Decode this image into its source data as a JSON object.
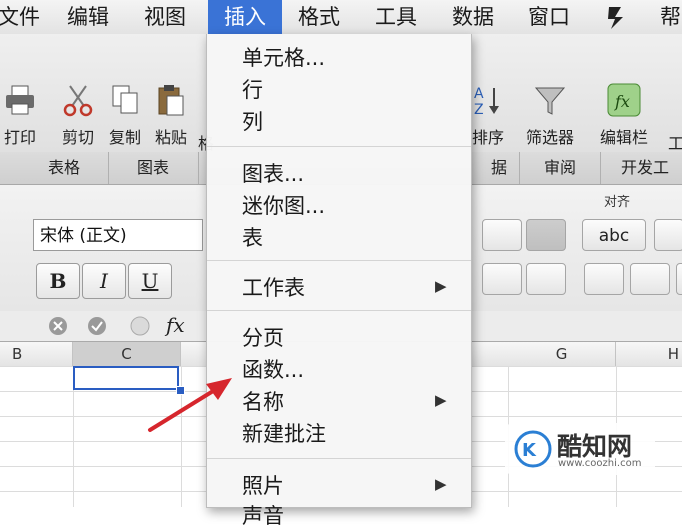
{
  "menubar": {
    "items": [
      "文件",
      "编辑",
      "视图",
      "插入",
      "格式",
      "工具",
      "数据",
      "窗口",
      "帮"
    ],
    "active_index": 3
  },
  "toolbar": {
    "buttons": [
      "打印",
      "剪切",
      "复制",
      "粘贴",
      "格",
      "排序",
      "筛选器",
      "编辑栏"
    ],
    "partial_right": "工"
  },
  "ribbon_tabs": [
    "表格",
    "图表",
    "据",
    "审阅",
    "开发工"
  ],
  "ribbon": {
    "font_name": "宋体 (正文)",
    "bold": "B",
    "italic": "I",
    "underline": "U",
    "wrap_text": "abc",
    "group_label": "对齐"
  },
  "formula_bar": {
    "fx": "fx"
  },
  "columns": [
    "B",
    "C",
    "G",
    "H"
  ],
  "selected_column": "C",
  "insert_menu": {
    "groups": [
      [
        "单元格...",
        "行",
        "列"
      ],
      [
        "图表...",
        "迷你图...",
        "表"
      ],
      [
        "工作表"
      ],
      [
        "分页",
        "函数...",
        "名称",
        "新建批注"
      ],
      [
        "照片",
        "声音"
      ]
    ],
    "submenu_arrow": "▶"
  },
  "watermark": {
    "brand": "酷知网",
    "url": "www.coozhi.com"
  },
  "colors": {
    "menu_highlight": "#3a73d6",
    "annotation_arrow": "#d6262d",
    "selection": "#2a5dc2"
  }
}
